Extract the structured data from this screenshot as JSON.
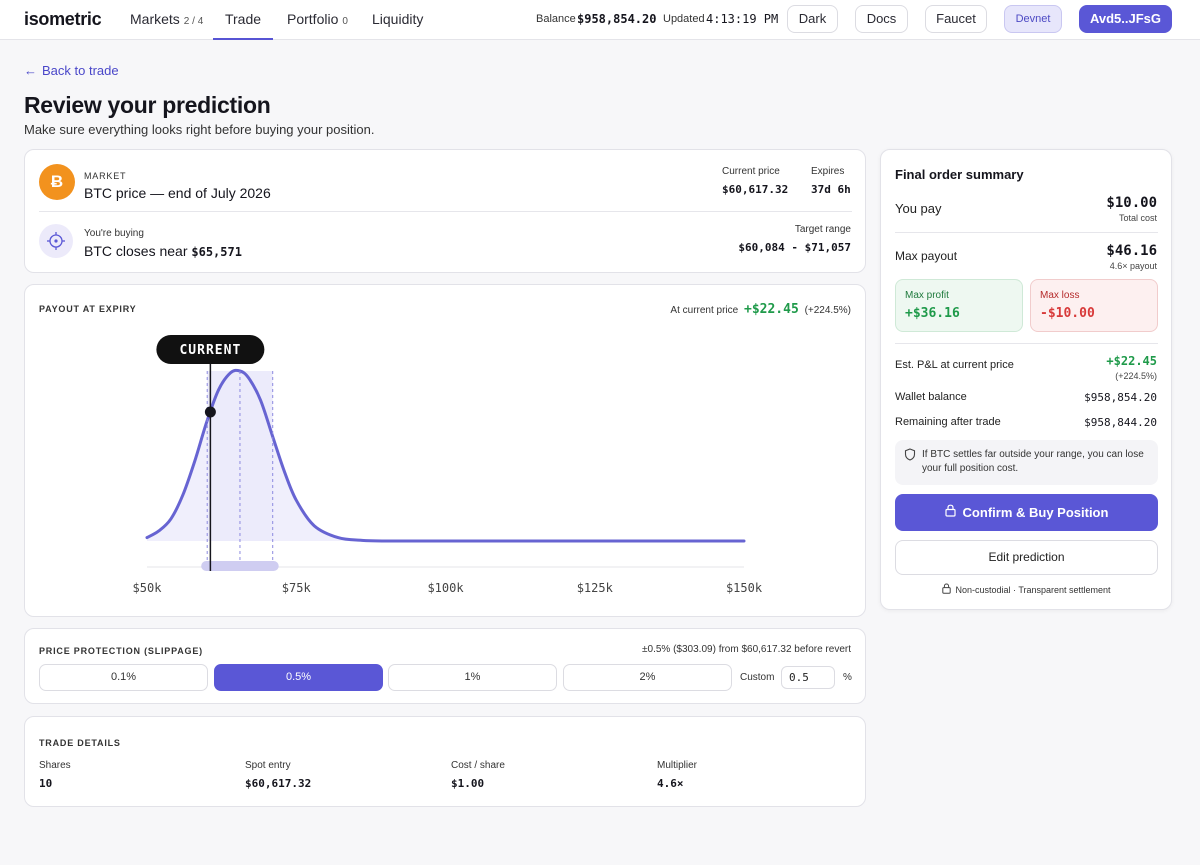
{
  "nav": {
    "logo": "isometric",
    "tabs": [
      {
        "label": "Markets",
        "sub": "2 / 4"
      },
      {
        "label": "Trade",
        "sub": ""
      },
      {
        "label": "Portfolio",
        "sub": "0"
      },
      {
        "label": "Liquidity",
        "sub": ""
      }
    ],
    "balance_label": "Balance",
    "balance_value": "$958,854.20",
    "updated_label": "Updated",
    "updated_value": "4:13:19 PM",
    "dark_label": "Dark",
    "docs_label": "Docs",
    "faucet_label": "Faucet",
    "network_label": "Devnet",
    "wallet_label": "Avd5..JFsG"
  },
  "page": {
    "back_label": "Back to trade",
    "title": "Review your prediction",
    "subtitle": "Make sure everything looks right before buying your position."
  },
  "market": {
    "icon_glyph": "Ƀ",
    "caption": "MARKET",
    "name": "BTC price — end of July 2026",
    "current_price_label": "Current price",
    "current_price": "$60,617.32",
    "expires_label": "Expires",
    "expires": "37d 6h",
    "buying_label": "You're buying",
    "buying_text": "BTC closes near",
    "buying_value": "$65,571",
    "target_label": "Target range",
    "target_range": "$60,084 - $71,057"
  },
  "chart_data": {
    "type": "area",
    "title": "PAYOUT AT EXPIRY",
    "at_price_label": "At current price",
    "at_price_value": "+$22.45",
    "at_price_pct": "(+224.5%)",
    "current_marker_label": "CURRENT",
    "x_ticks": [
      "$50k",
      "$75k",
      "$100k",
      "$125k",
      "$150k"
    ],
    "xlim": [
      50000,
      150000
    ],
    "current_price": 60617,
    "range": [
      60084,
      71057
    ],
    "center": 65571,
    "series": [
      {
        "x": [
          50000,
          52000,
          54000,
          56000,
          58000,
          60000,
          62000,
          64000,
          65571,
          67000,
          69000,
          71000,
          73000,
          75000,
          78000,
          82000,
          86000,
          90000,
          100000,
          125000,
          150000
        ],
        "y": [
          0.02,
          0.06,
          0.13,
          0.27,
          0.47,
          0.7,
          0.89,
          0.99,
          1.0,
          0.96,
          0.83,
          0.62,
          0.41,
          0.24,
          0.09,
          0.02,
          0.004,
          0.0,
          0.0,
          0.0,
          0.0
        ]
      }
    ],
    "accent": "#6764d2"
  },
  "slippage": {
    "title": "PRICE PROTECTION (SLIPPAGE)",
    "note": "±0.5% ($303.09) from $60,617.32 before revert",
    "options": [
      "0.1%",
      "0.5%",
      "1%",
      "2%"
    ],
    "selected": "0.5%",
    "custom_label": "Custom",
    "custom_value": "0.5",
    "percent_sign": "%"
  },
  "details": {
    "title": "TRADE DETAILS",
    "items": [
      {
        "label": "Shares",
        "value": "10"
      },
      {
        "label": "Spot entry",
        "value": "$60,617.32"
      },
      {
        "label": "Cost / share",
        "value": "$1.00"
      },
      {
        "label": "Multiplier",
        "value": "4.6×"
      }
    ]
  },
  "summary": {
    "title": "Final order summary",
    "you_pay_label": "You pay",
    "you_pay": "$10.00",
    "total_cost_label": "Total cost",
    "max_payout_label": "Max payout",
    "max_payout": "$46.16",
    "payout_note": "4.6× payout",
    "max_profit_label": "Max profit",
    "max_profit": "+$36.16",
    "max_loss_label": "Max loss",
    "max_loss": "-$10.00",
    "est_pnl_label": "Est. P&L at current price",
    "est_pnl": "+$22.45",
    "est_pnl_pct": "(+224.5%)",
    "wallet_label": "Wallet balance",
    "wallet_value": "$958,854.20",
    "remaining_label": "Remaining after trade",
    "remaining_value": "$958,844.20",
    "warning": "If BTC settles far outside your range, you can lose your full position cost.",
    "confirm_label": "Confirm & Buy Position",
    "edit_label": "Edit prediction",
    "footer": "Non-custodial · Transparent settlement",
    "profit_color": "#1f9a4a",
    "loss_color": "#d83a3a"
  }
}
